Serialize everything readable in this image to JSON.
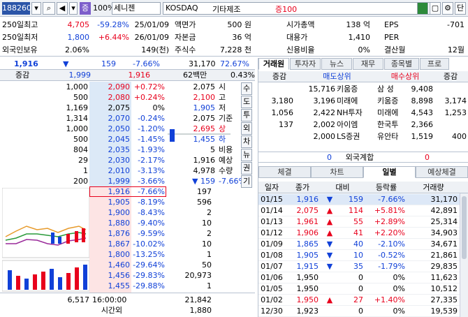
{
  "toolbar": {
    "code": "188260",
    "zoom": "100%",
    "stock_name": "세니젠",
    "market": "KOSDAQ",
    "sector": "기타제조",
    "margin": "증100",
    "badge": "증"
  },
  "info": [
    {
      "l1": "250일최고",
      "v1": "4,705",
      "p1": "-59.28%",
      "d1": "25/01/09",
      "l2": "액면가",
      "v2": "500 원",
      "l3": "시가총액",
      "v3": "138 억",
      "l4": "EPS",
      "v4": "-701"
    },
    {
      "l1": "250일최저",
      "v1": "1,800",
      "p1": "+6.44%",
      "d1": "26/01/09",
      "l2": "자본금",
      "v2": "36 억",
      "l3": "대용가",
      "v3": "1,410",
      "l4": "PER",
      "v4": ""
    },
    {
      "l1": "외국인보유",
      "v1": "2.06%",
      "p1": "",
      "d1": "149(천)",
      "l2": "주식수",
      "v2": "7,228 천",
      "l3": "신용비율",
      "v3": "0%",
      "l4": "결산월",
      "v4": "12월"
    }
  ],
  "quote": {
    "price": "1,916",
    "arrow": "▼",
    "change": "159",
    "rate": "-7.66%",
    "volume": "31,170",
    "vol_rate": "72.67%",
    "label_change": "증감",
    "bid_total": "1,999",
    "ask_total": "1,916",
    "amount": "62백만",
    "turnover": "0.43%"
  },
  "ask_rows": [
    {
      "qty": "1,000",
      "price": "2,090",
      "rate": "+0.72%",
      "k": "2,075",
      "kl": "시"
    },
    {
      "qty": "500",
      "price": "2,080",
      "rate": "+0.24%",
      "k": "2,100",
      "kl": "고"
    },
    {
      "qty": "1,169",
      "price": "2,075",
      "rate": "0%",
      "k": "1,905",
      "kl": "저"
    },
    {
      "qty": "1,314",
      "price": "2,070",
      "rate": "-0.24%",
      "k": "2,075",
      "kl": "기준"
    },
    {
      "qty": "1,000",
      "price": "2,050",
      "rate": "-1.20%",
      "k": "2,695",
      "kl": "상"
    },
    {
      "qty": "500",
      "price": "2,045",
      "rate": "-1.45%",
      "k": "1,455",
      "kl": "하"
    },
    {
      "qty": "804",
      "price": "2,035",
      "rate": "-1.93%",
      "k": "5",
      "kl": "비용"
    },
    {
      "qty": "29",
      "price": "2,030",
      "rate": "-2.17%",
      "k": "1,916",
      "kl": "예상"
    },
    {
      "qty": "1",
      "price": "2,010",
      "rate": "-3.13%",
      "k": "4,978",
      "kl": "수량"
    },
    {
      "qty": "200",
      "price": "1,999",
      "rate": "-3.66%",
      "k": "▼ 159",
      "kl": "-7.66%"
    }
  ],
  "bid_rows": [
    {
      "price": "1,916",
      "rate": "-7.66%",
      "qty": "197"
    },
    {
      "price": "1,905",
      "rate": "-8.19%",
      "qty": "596"
    },
    {
      "price": "1,900",
      "rate": "-8.43%",
      "qty": "2"
    },
    {
      "price": "1,880",
      "rate": "-9.40%",
      "qty": "10"
    },
    {
      "price": "1,876",
      "rate": "-9.59%",
      "qty": "2"
    },
    {
      "price": "1,867",
      "rate": "-10.02%",
      "qty": "10"
    },
    {
      "price": "1,800",
      "rate": "-13.25%",
      "qty": "1"
    },
    {
      "price": "1,460",
      "rate": "-29.64%",
      "qty": "50"
    },
    {
      "price": "1,456",
      "rate": "-29.83%",
      "qty": "20,973"
    },
    {
      "price": "1,455",
      "rate": "-29.88%",
      "qty": "1"
    }
  ],
  "bottom": {
    "ask_sum": "6,517",
    "time": "16:00:00",
    "bid_sum": "21,842",
    "after_label": "시간외",
    "after_val": "1,880"
  },
  "side_buttons": [
    "수",
    "도",
    "투",
    "외",
    "차",
    "뉴",
    "권",
    "기"
  ],
  "right_tabs": [
    "거래원",
    "투자자",
    "뉴스",
    "재무",
    "종목별",
    "프로"
  ],
  "broker_headers": [
    "증감",
    "매도상위",
    "매수상위",
    "증감"
  ],
  "brokers": [
    {
      "d1": "",
      "sv": "15,716",
      "sn": "키움증",
      "bn": "삼 성",
      "bv": "9,408",
      "d2": ""
    },
    {
      "d1": "3,180",
      "sv": "3,196",
      "sn": "미래에",
      "bn": "키움증",
      "bv": "8,898",
      "d2": "3,174"
    },
    {
      "d1": "1,056",
      "sv": "2,422",
      "sn": "NH투자",
      "bn": "미래에",
      "bv": "4,543",
      "d2": "1,253"
    },
    {
      "d1": "137",
      "sv": "2,002",
      "sn": "아이엠",
      "bn": "한국투",
      "bv": "2,366",
      "d2": ""
    },
    {
      "d1": "",
      "sv": "2,000",
      "sn": "LS증권",
      "bn": "유안타",
      "bv": "1,519",
      "d2": "400"
    }
  ],
  "foreign": {
    "left": "0",
    "label": "외국계합",
    "right": "0"
  },
  "lower_tabs": [
    "체결",
    "차트",
    "일별",
    "예상체결"
  ],
  "daily_headers": [
    "일자",
    "종가",
    "대비",
    "등락률",
    "거래량"
  ],
  "daily": [
    {
      "date": "01/15",
      "close": "1,916",
      "arrow": "▼",
      "diff": "159",
      "rate": "-7.66%",
      "vol": "31,170",
      "dir": "down",
      "hl": true
    },
    {
      "date": "01/14",
      "close": "2,075",
      "arrow": "▲",
      "diff": "114",
      "rate": "+5.81%",
      "vol": "42,891",
      "dir": "up"
    },
    {
      "date": "01/13",
      "close": "1,961",
      "arrow": "▲",
      "diff": "55",
      "rate": "+2.89%",
      "vol": "25,314",
      "dir": "up"
    },
    {
      "date": "01/12",
      "close": "1,906",
      "arrow": "▲",
      "diff": "41",
      "rate": "+2.20%",
      "vol": "34,903",
      "dir": "up"
    },
    {
      "date": "01/09",
      "close": "1,865",
      "arrow": "▼",
      "diff": "40",
      "rate": "-2.10%",
      "vol": "34,671",
      "dir": "down"
    },
    {
      "date": "01/08",
      "close": "1,905",
      "arrow": "▼",
      "diff": "10",
      "rate": "-0.52%",
      "vol": "21,861",
      "dir": "down"
    },
    {
      "date": "01/07",
      "close": "1,915",
      "arrow": "▼",
      "diff": "35",
      "rate": "-1.79%",
      "vol": "29,835",
      "dir": "down"
    },
    {
      "date": "01/06",
      "close": "1,950",
      "arrow": "",
      "diff": "0",
      "rate": "0%",
      "vol": "11,623",
      "dir": "flat"
    },
    {
      "date": "01/05",
      "close": "1,950",
      "arrow": "",
      "diff": "0",
      "rate": "0%",
      "vol": "10,512",
      "dir": "flat"
    },
    {
      "date": "01/02",
      "close": "1,950",
      "arrow": "▲",
      "diff": "27",
      "rate": "+1.40%",
      "vol": "27,335",
      "dir": "up"
    },
    {
      "date": "12/30",
      "close": "1,923",
      "arrow": "",
      "diff": "0",
      "rate": "0%",
      "vol": "19,539",
      "dir": "flat"
    }
  ],
  "colors": {
    "up": "#e8001c",
    "down": "#1141d8",
    "ask_bg": "#dce9f7",
    "bid_bg": "#fde4e4"
  }
}
